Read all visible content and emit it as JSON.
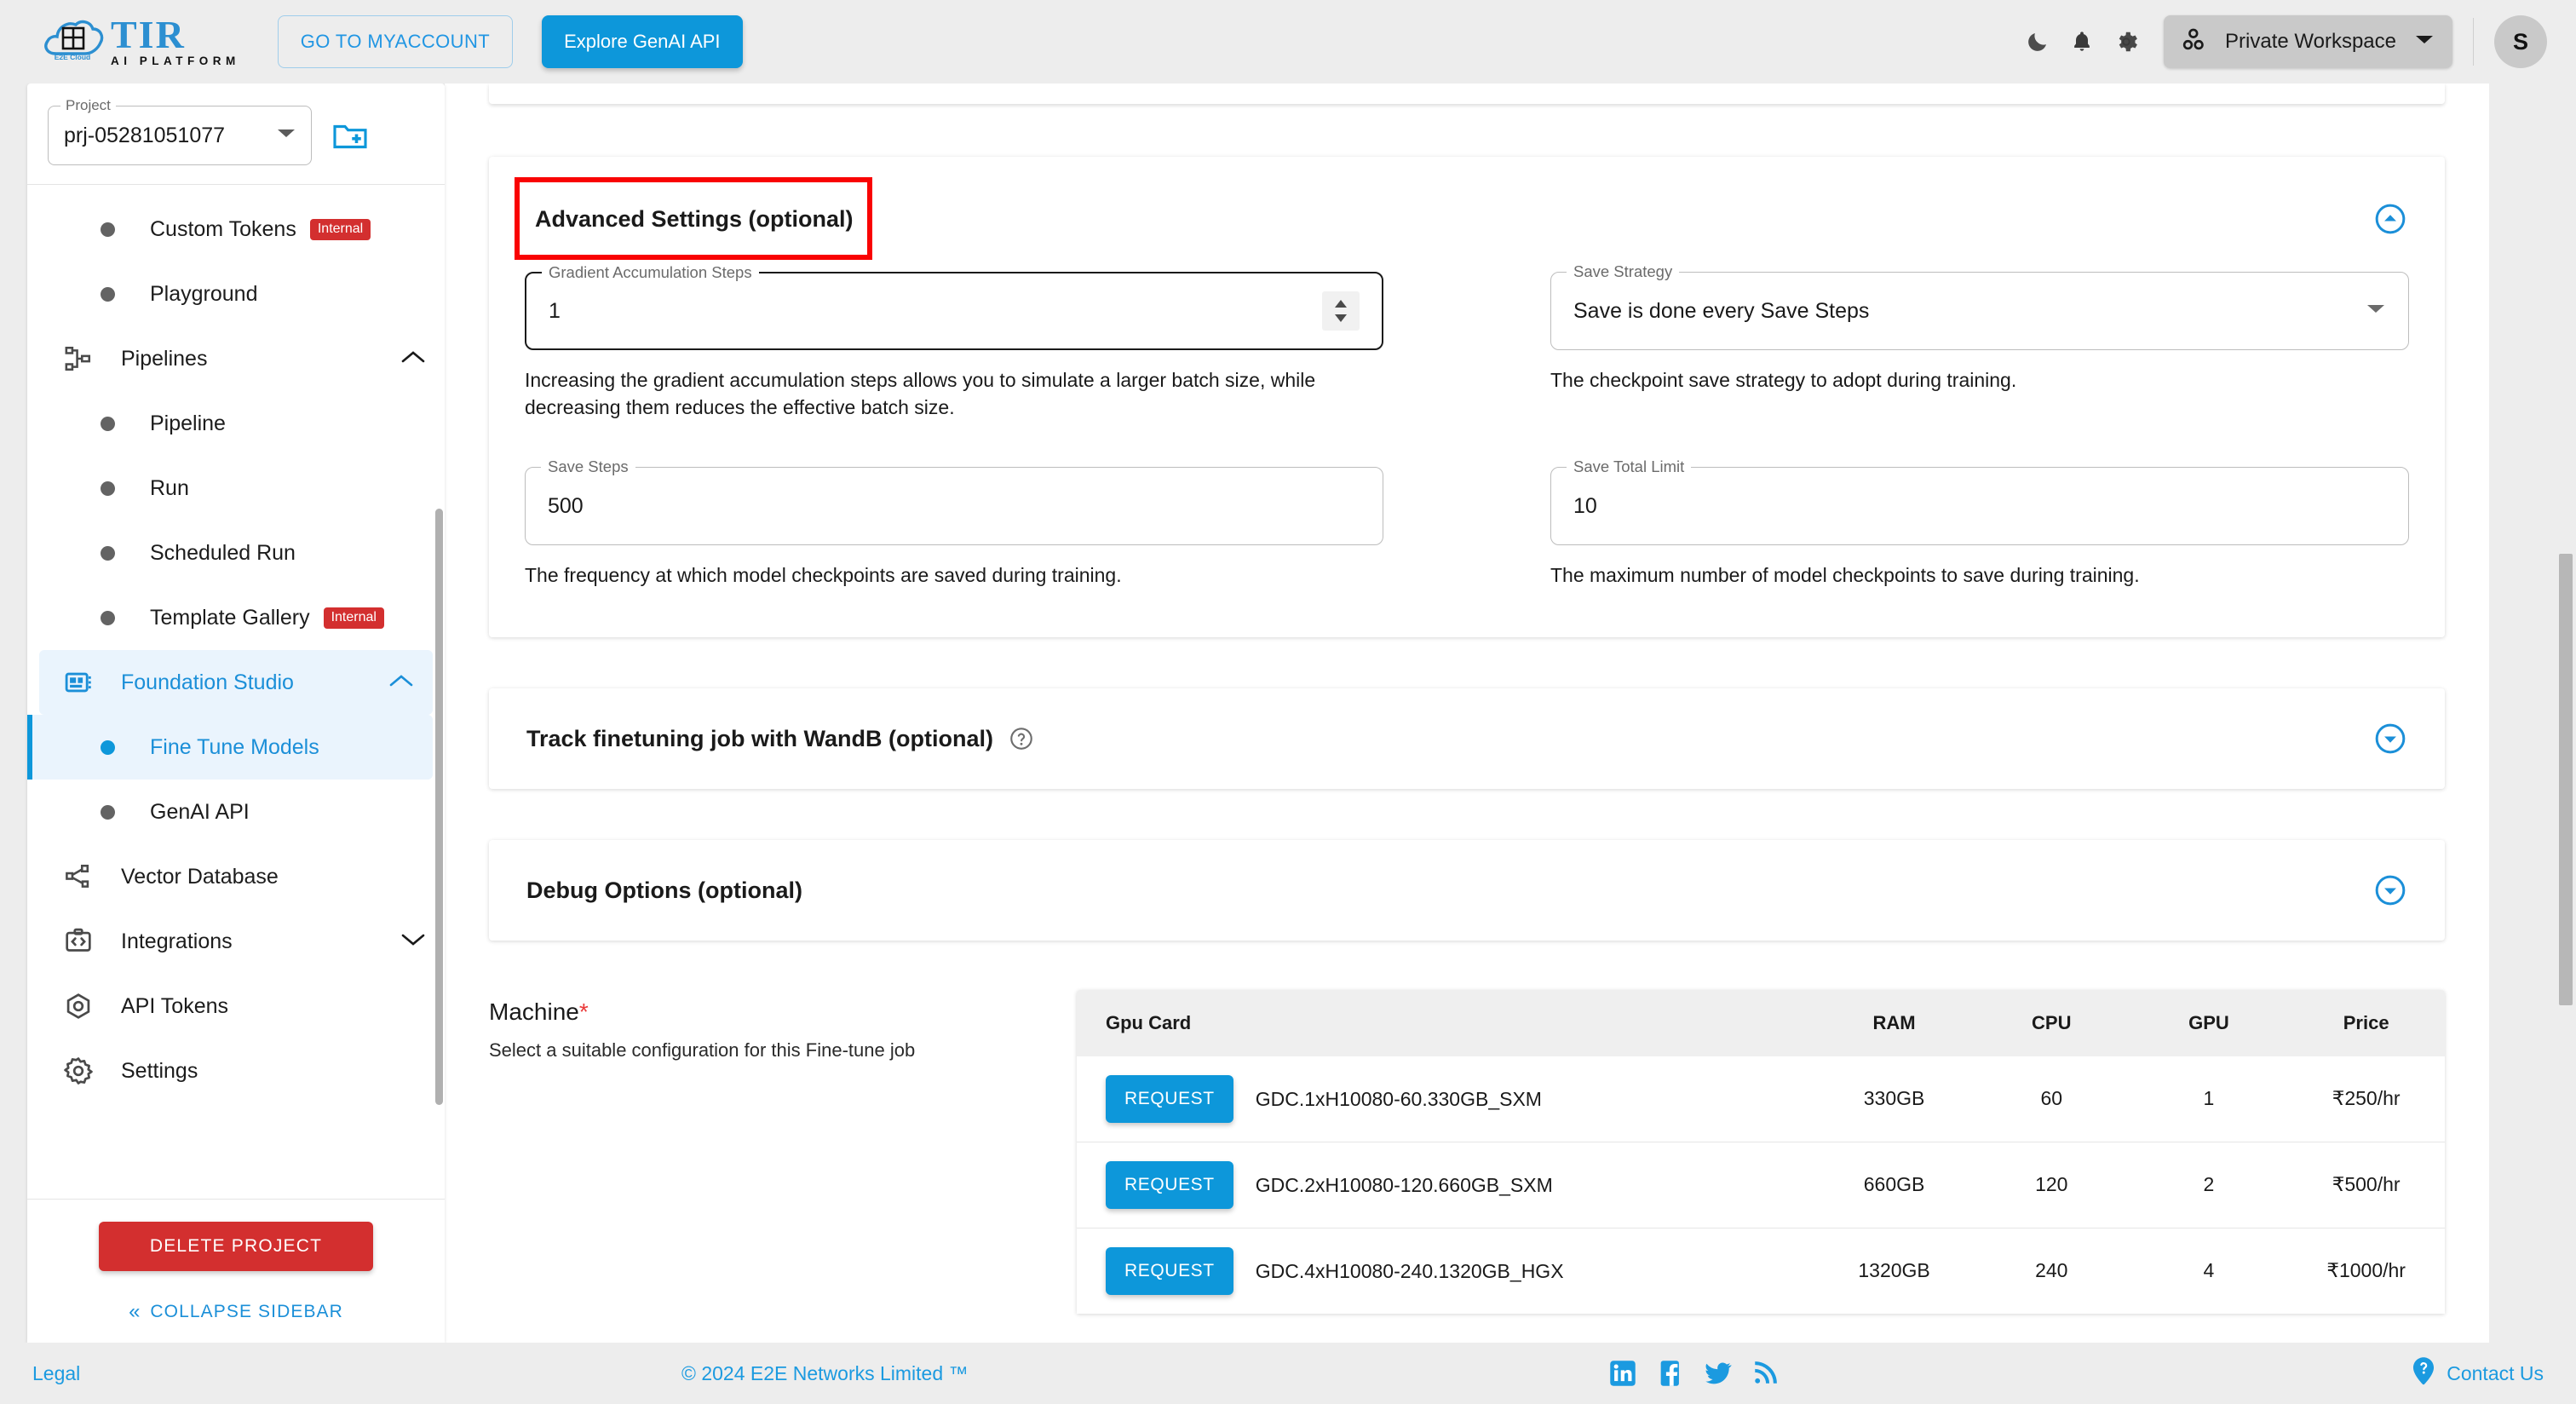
{
  "header": {
    "logo_name": "TIR",
    "logo_tagline": "AI PLATFORM",
    "logo_cloud_label": "E2E Cloud",
    "myaccount_label": "GO TO MYACCOUNT",
    "genai_label": "Explore GenAI API",
    "dark_mode_icon": "moon-icon",
    "notifications_icon": "bell-icon",
    "settings_icon": "gear-icon",
    "workspace_label": "Private Workspace",
    "avatar_initial": "S",
    "accent_color": "#0d97da"
  },
  "sidebar": {
    "project_label": "Project",
    "project_value": "prj-05281051077",
    "new_project_icon": "new-folder-icon",
    "items": [
      {
        "label": "Custom Tokens",
        "type": "sub",
        "badge": "Internal",
        "state": "normal"
      },
      {
        "label": "Playground",
        "type": "sub",
        "badge": "",
        "state": "normal"
      },
      {
        "label": "Pipelines",
        "type": "group",
        "badge": "",
        "state": "expanded",
        "icon": "pipelines-icon"
      },
      {
        "label": "Pipeline",
        "type": "sub",
        "badge": "",
        "state": "normal"
      },
      {
        "label": "Run",
        "type": "sub",
        "badge": "",
        "state": "normal"
      },
      {
        "label": "Scheduled Run",
        "type": "sub",
        "badge": "",
        "state": "normal"
      },
      {
        "label": "Template Gallery",
        "type": "sub",
        "badge": "Internal",
        "state": "normal"
      },
      {
        "label": "Foundation Studio",
        "type": "group",
        "badge": "",
        "state": "expanded-active",
        "icon": "foundation-studio-icon"
      },
      {
        "label": "Fine Tune Models",
        "type": "sub",
        "badge": "",
        "state": "active"
      },
      {
        "label": "GenAI API",
        "type": "sub",
        "badge": "",
        "state": "normal"
      },
      {
        "label": "Vector Database",
        "type": "item",
        "badge": "",
        "state": "normal",
        "icon": "vector-database-icon"
      },
      {
        "label": "Integrations",
        "type": "group",
        "badge": "",
        "state": "collapsed",
        "icon": "integrations-icon"
      },
      {
        "label": "API Tokens",
        "type": "item",
        "badge": "",
        "state": "normal",
        "icon": "api-tokens-icon"
      },
      {
        "label": "Settings",
        "type": "item",
        "badge": "",
        "state": "normal",
        "icon": "settings-gear-icon"
      }
    ],
    "delete_project_label": "DELETE PROJECT",
    "collapse_label": "COLLAPSE SIDEBAR",
    "badge_color": "#d32f2f"
  },
  "main": {
    "advanced": {
      "title": "Advanced Settings (optional)",
      "highlight_color": "#f90303",
      "expander_icon": "circle-chevron-up-icon",
      "fields": [
        {
          "label": "Gradient Accumulation Steps",
          "value": "1",
          "control": "stepper",
          "help": "Increasing the gradient accumulation steps allows you to simulate a larger batch size, while decreasing them reduces the effective batch size."
        },
        {
          "label": "Save Strategy",
          "value": "Save is done every Save Steps",
          "control": "select",
          "help": "The checkpoint save strategy to adopt during training."
        },
        {
          "label": "Save Steps",
          "value": "500",
          "control": "text",
          "help": "The frequency at which model checkpoints are saved during training."
        },
        {
          "label": "Save Total Limit",
          "value": "10",
          "control": "text",
          "help": "The maximum number of model checkpoints to save during training."
        }
      ]
    },
    "wandb": {
      "title": "Track finetuning job with WandB (optional)",
      "help_icon": "question-circle-icon",
      "expander_icon": "circle-chevron-down-icon"
    },
    "debug": {
      "title": "Debug Options (optional)",
      "expander_icon": "circle-chevron-down-icon"
    },
    "machine": {
      "title": "Machine",
      "required_marker": "*",
      "subtitle": "Select a suitable configuration for this Fine-tune job",
      "columns": [
        "Gpu Card",
        "RAM",
        "CPU",
        "GPU",
        "Price"
      ],
      "request_label": "REQUEST",
      "rows": [
        {
          "name": "GDC.1xH10080-60.330GB_SXM",
          "ram": "330GB",
          "cpu": "60",
          "gpu": "1",
          "price": "₹250/hr"
        },
        {
          "name": "GDC.2xH10080-120.660GB_SXM",
          "ram": "660GB",
          "cpu": "120",
          "gpu": "2",
          "price": "₹500/hr"
        },
        {
          "name": "GDC.4xH10080-240.1320GB_HGX",
          "ram": "1320GB",
          "cpu": "240",
          "gpu": "4",
          "price": "₹1000/hr"
        }
      ]
    }
  },
  "footer": {
    "legal": "Legal",
    "copyright": "© 2024 E2E Networks Limited ™",
    "social": [
      "linkedin-icon",
      "facebook-icon",
      "twitter-icon",
      "rss-icon"
    ],
    "contact": "Contact Us",
    "contact_icon": "help-pin-icon"
  }
}
